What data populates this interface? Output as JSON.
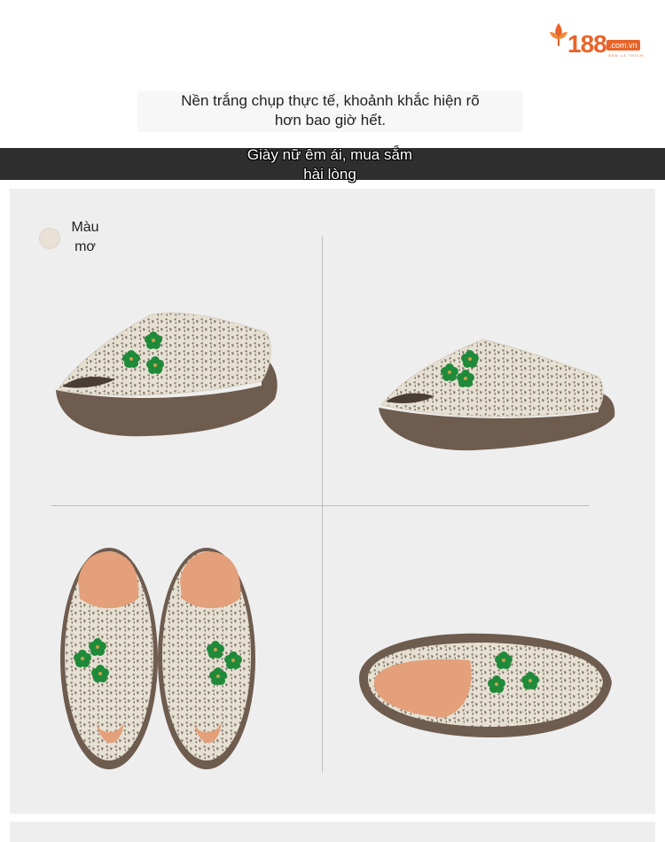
{
  "logo": {
    "number": "188",
    "domain": ".com.vn",
    "slogan": "XEM LÀ THÍCH"
  },
  "intro": {
    "line1": "Nền trắng chụp thực tế, khoảnh khắc hiện rõ",
    "line2": "hơn bao giờ hết."
  },
  "banner": {
    "line1": "Giày nữ êm ái, mua sắm",
    "line2": "hài lòng"
  },
  "color_option": {
    "line1": "Màu",
    "line2": "mơ",
    "swatch_color": "#e9e1d6"
  },
  "colors": {
    "brand": "#e8642a",
    "leather": "#e6e0d2",
    "sole": "#6e5c4f",
    "flower": "#1f8a3a",
    "insole": "#e3a07a"
  }
}
